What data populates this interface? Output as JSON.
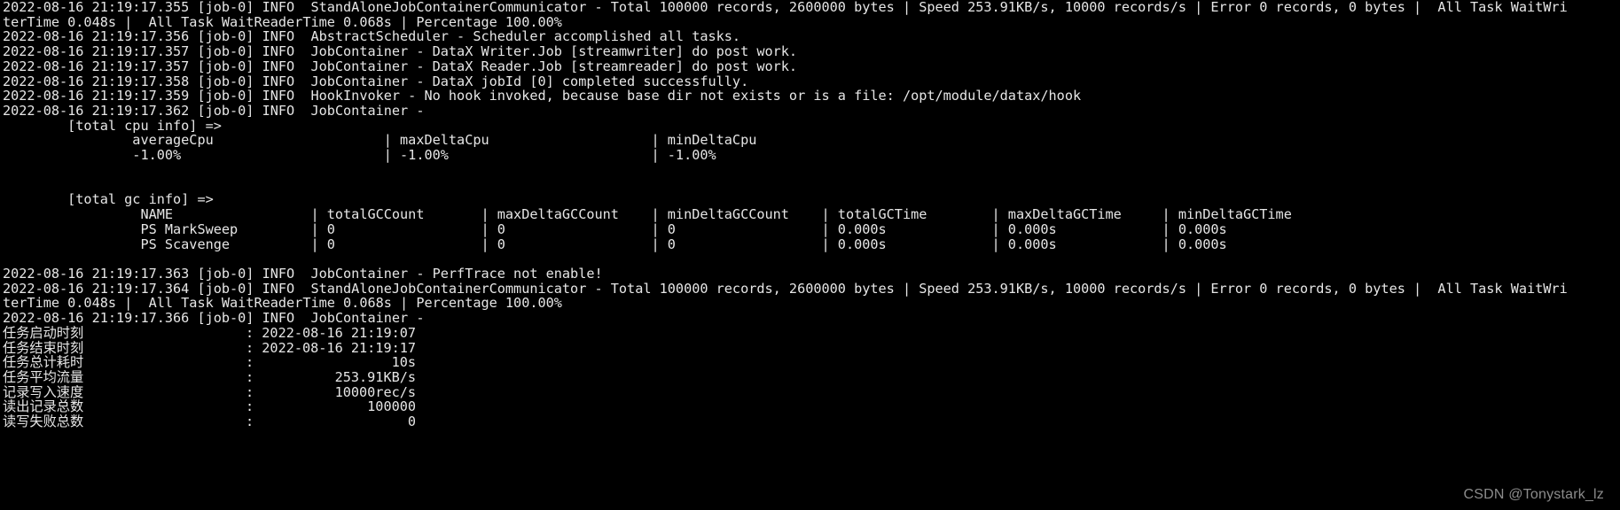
{
  "terminal": {
    "background_color": "#000000",
    "foreground_color": "#e6e6e6",
    "watermark_color": "#8c8c8c",
    "watermark": "CSDN @Tonystark_lz",
    "lines": [
      "2022-08-16 21:19:17.355 [job-0] INFO  StandAloneJobContainerCommunicator - Total 100000 records, 2600000 bytes | Speed 253.91KB/s, 10000 records/s | Error 0 records, 0 bytes |  All Task WaitWri",
      "terTime 0.048s |  All Task WaitReaderTime 0.068s | Percentage 100.00%",
      "2022-08-16 21:19:17.356 [job-0] INFO  AbstractScheduler - Scheduler accomplished all tasks.",
      "2022-08-16 21:19:17.357 [job-0] INFO  JobContainer - DataX Writer.Job [streamwriter] do post work.",
      "2022-08-16 21:19:17.357 [job-0] INFO  JobContainer - DataX Reader.Job [streamreader] do post work.",
      "2022-08-16 21:19:17.358 [job-0] INFO  JobContainer - DataX jobId [0] completed successfully.",
      "2022-08-16 21:19:17.359 [job-0] INFO  HookInvoker - No hook invoked, because base dir not exists or is a file: /opt/module/datax/hook",
      "2022-08-16 21:19:17.362 [job-0] INFO  JobContainer - ",
      "        [total cpu info] =>",
      "                averageCpu                     | maxDeltaCpu                    | minDeltaCpu",
      "                -1.00%                         | -1.00%                         | -1.00%",
      "",
      "",
      "        [total gc info] =>",
      "                 NAME                 | totalGCCount       | maxDeltaGCCount    | minDeltaGCCount    | totalGCTime        | maxDeltaGCTime     | minDeltaGCTime",
      "                 PS MarkSweep         | 0                  | 0                  | 0                  | 0.000s             | 0.000s             | 0.000s",
      "                 PS Scavenge          | 0                  | 0                  | 0                  | 0.000s             | 0.000s             | 0.000s",
      "",
      "2022-08-16 21:19:17.363 [job-0] INFO  JobContainer - PerfTrace not enable!",
      "2022-08-16 21:19:17.364 [job-0] INFO  StandAloneJobContainerCommunicator - Total 100000 records, 2600000 bytes | Speed 253.91KB/s, 10000 records/s | Error 0 records, 0 bytes |  All Task WaitWri",
      "terTime 0.048s |  All Task WaitReaderTime 0.068s | Percentage 100.00%",
      "2022-08-16 21:19:17.366 [job-0] INFO  JobContainer - ",
      "任务启动时刻                    : 2022-08-16 21:19:07",
      "任务结束时刻                    : 2022-08-16 21:19:17",
      "任务总计耗时                    :                 10s",
      "任务平均流量                    :          253.91KB/s",
      "记录写入速度                    :          10000rec/s",
      "读出记录总数                    :              100000",
      "读写失败总数                    :                   0"
    ]
  }
}
